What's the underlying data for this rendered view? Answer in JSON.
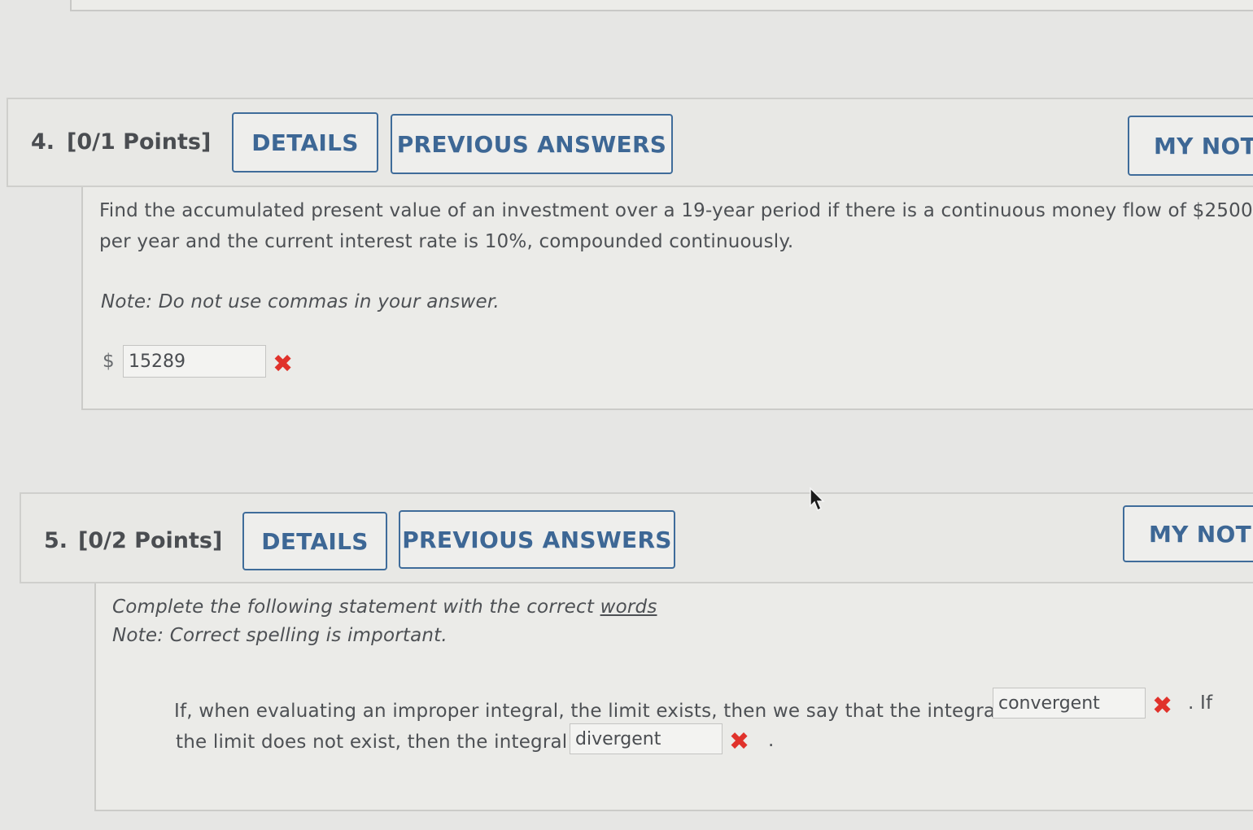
{
  "questions": [
    {
      "number_label": "4.",
      "points_label": "[0/1 Points]",
      "details_label": "DETAILS",
      "previous_answers_label": "PREVIOUS ANSWERS",
      "my_notes_label": "MY NOTE",
      "prompt_line1": "Find the accumulated present value of an investment over a 19-year period if there is a continuous money flow of $2500",
      "prompt_line2": "per year and the current interest rate is 10%, compounded continuously.",
      "note": "Note: Do not use commas in your answer.",
      "currency_symbol": "$",
      "answer_value": "15289",
      "answer_status": "incorrect"
    },
    {
      "number_label": "5.",
      "points_label": "[0/2 Points]",
      "details_label": "DETAILS",
      "previous_answers_label": "PREVIOUS ANSWERS",
      "my_notes_label": "MY NOTES",
      "instruction_prefix": "Complete the following statement with the correct ",
      "instruction_link": "words",
      "note": "Note: Correct spelling is important.",
      "sentence_part1": "If, when evaluating an improper integral, the limit exists, then we say that the integral",
      "answer1_value": "convergent",
      "answer1_status": "incorrect",
      "sentence_part2": ". If",
      "sentence_part3": "the limit does not exist, then the integral",
      "answer2_value": "divergent",
      "answer2_status": "incorrect",
      "sentence_end": "."
    }
  ],
  "icons": {
    "incorrect": "x-mark-icon",
    "incorrect_color": "#e0322b",
    "cursor": "mouse-pointer-icon"
  },
  "colors": {
    "button_text": "#3d6795",
    "button_border": "#3f6c9a",
    "page_background": "#e6e6e4"
  }
}
